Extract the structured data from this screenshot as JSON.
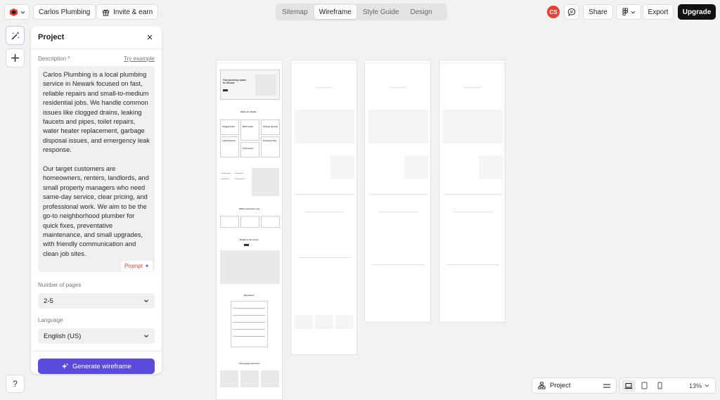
{
  "header": {
    "project_name": "Carlos Plumbing",
    "invite_label": "Invite & earn",
    "tabs": [
      {
        "label": "Sitemap",
        "active": false
      },
      {
        "label": "Wireframe",
        "active": true
      },
      {
        "label": "Style Guide",
        "active": false
      },
      {
        "label": "Design",
        "active": false
      }
    ],
    "avatar_initials": "CS",
    "share_label": "Share",
    "export_label": "Export",
    "upgrade_label": "Upgrade"
  },
  "panel": {
    "title": "Project",
    "description_label": "Description",
    "required_mark": "*",
    "try_example_label": "Try example",
    "description": "Carlos Plumbing is a local plumbing service in Newark focused on fast, reliable repairs and small-to-medium residential jobs. We handle common issues like clogged drains, leaking faucets and pipes, toilet repairs, water heater replacement, garbage disposal issues, and emergency leak response.\n\nOur target customers are homeowners, renters, landlords, and small property managers who need same-day service, clear pricing, and professional work. We aim to be the go-to neighborhood plumber for quick fixes, preventative maintenance, and small upgrades, with friendly communication and clean job sites.",
    "prompt_label": "Prompt",
    "pages_label": "Number of pages",
    "pages_value": "2-5",
    "language_label": "Language",
    "language_value": "English (US)",
    "generate_label": "Generate wireframe"
  },
  "canvas": {
    "hero_title": "Fast plumbing repairs for Newark",
    "section_services": "What we handle",
    "service_cards": [
      "Clogged drains",
      "Water heater",
      "Leaking faucets",
      "Garbage disposal",
      "Toilet repairs",
      "Emergency leak"
    ],
    "section_reviews": "What customers say",
    "section_cta": "Ready to fix it now",
    "section_faq": "Questions",
    "section_team": "The people behind it"
  },
  "bottom": {
    "project_label": "Project",
    "zoom_label": "13%"
  },
  "colors": {
    "accent": "#5b4bdb",
    "danger": "#e0453a",
    "dark": "#111111"
  }
}
